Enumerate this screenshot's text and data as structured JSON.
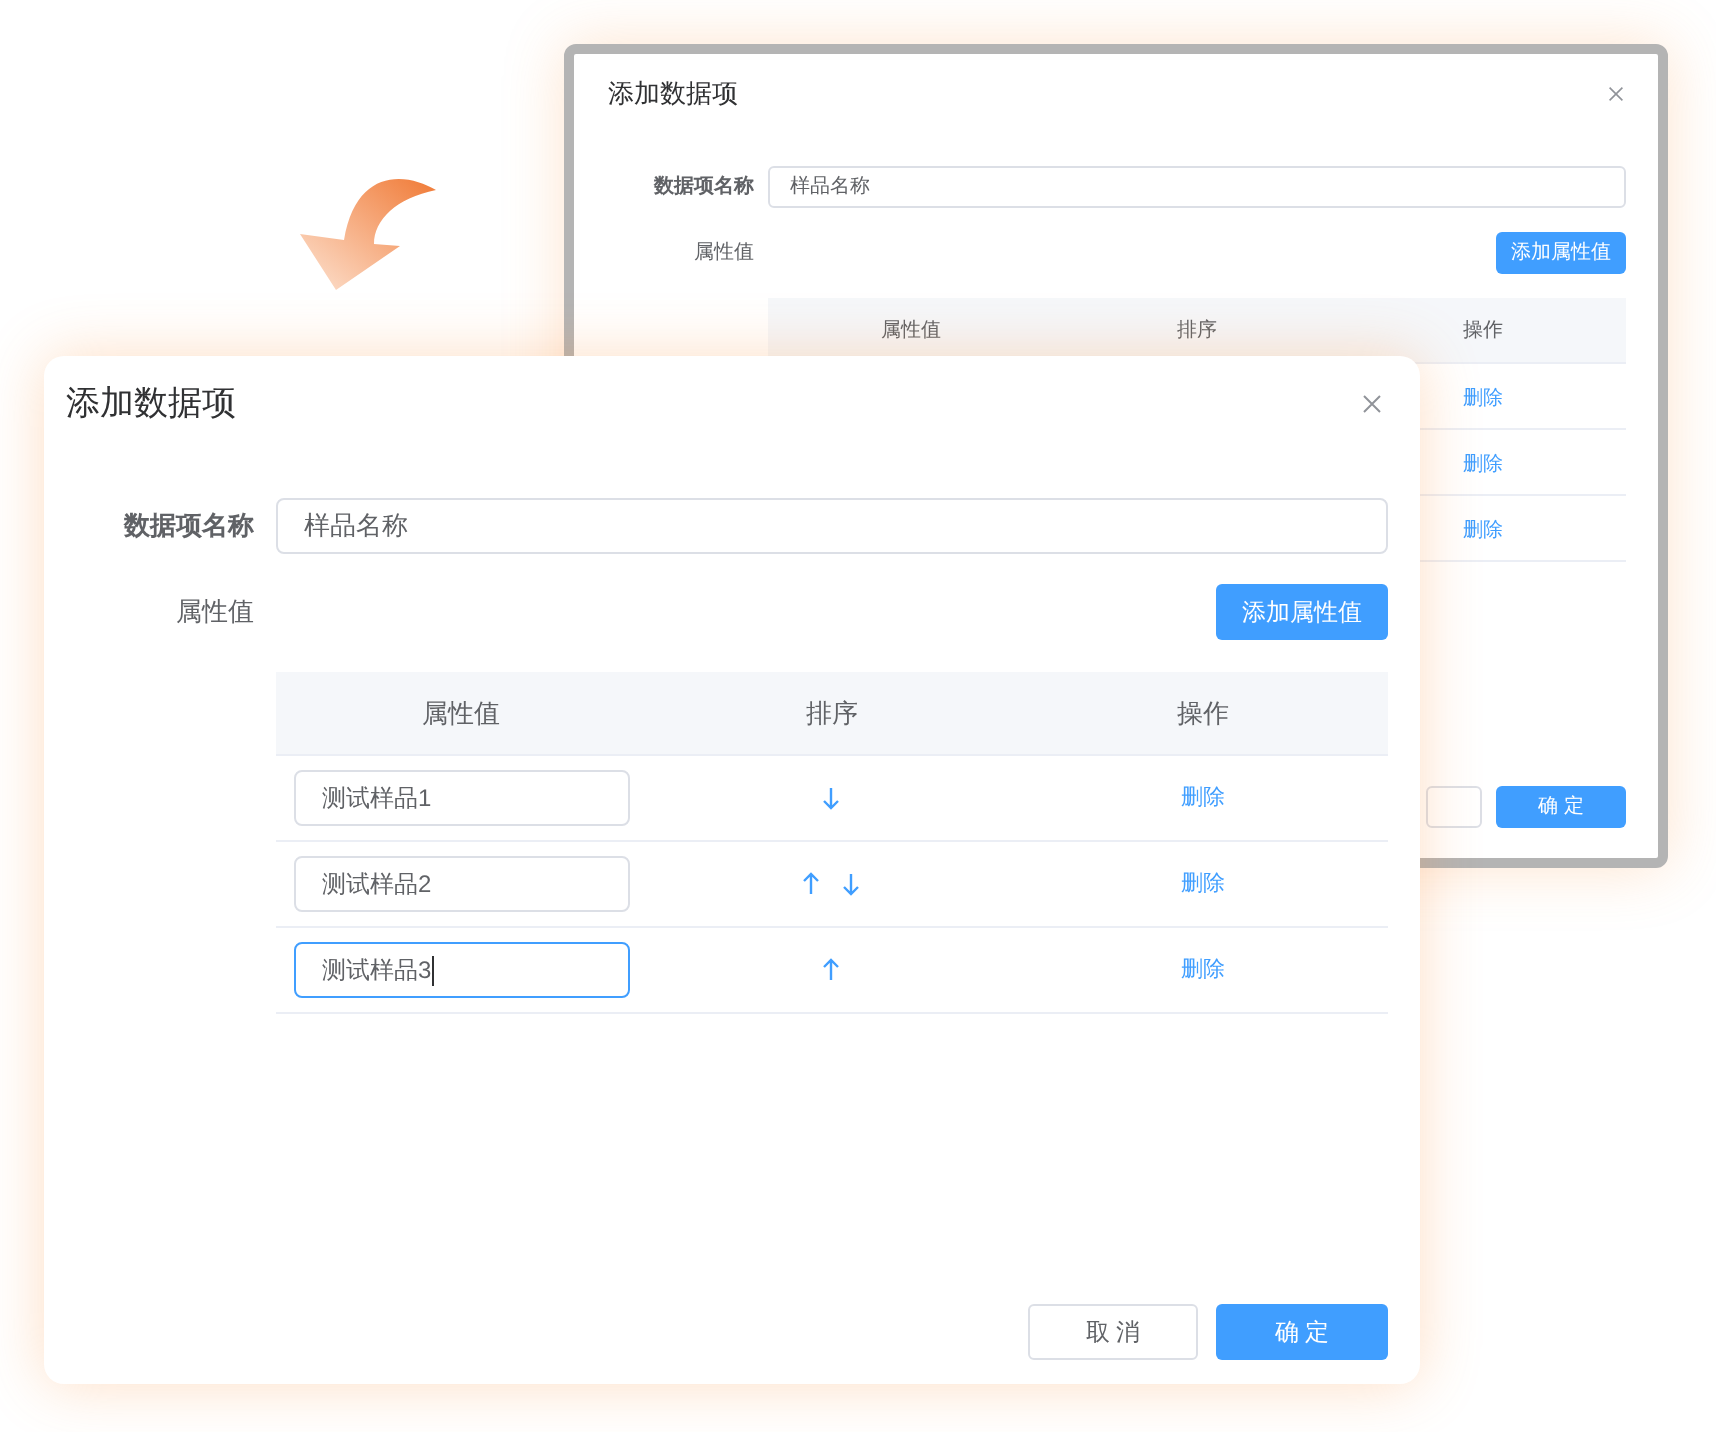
{
  "back_dialog": {
    "title": "添加数据项",
    "name_label": "数据项名称",
    "name_value": "样品名称",
    "attr_label": "属性值",
    "add_button": "添加属性值",
    "columns": [
      "属性值",
      "排序",
      "操作"
    ],
    "rows": [
      {
        "action": "删除"
      },
      {
        "action": "删除"
      },
      {
        "action": "删除"
      }
    ],
    "confirm_button": "确 定"
  },
  "front_dialog": {
    "title": "添加数据项",
    "name_label": "数据项名称",
    "name_value": "样品名称",
    "attr_label": "属性值",
    "add_button": "添加属性值",
    "columns": [
      "属性值",
      "排序",
      "操作"
    ],
    "rows": [
      {
        "value": "测试样品1",
        "focused": false,
        "move_up": false,
        "move_down": true,
        "action": "删除"
      },
      {
        "value": "测试样品2",
        "focused": false,
        "move_up": true,
        "move_down": true,
        "action": "删除"
      },
      {
        "value": "测试样品3",
        "focused": true,
        "move_up": true,
        "move_down": false,
        "action": "删除"
      }
    ],
    "cancel_button": "取 消",
    "confirm_button": "确 定"
  }
}
